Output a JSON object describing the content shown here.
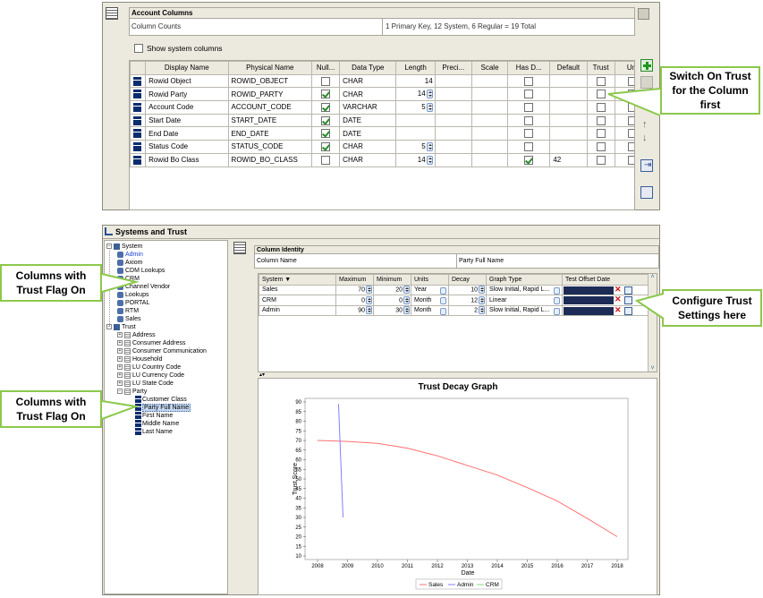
{
  "account_columns": {
    "header": "Account Columns",
    "counts_label": "Column Counts",
    "counts_value": "1 Primary Key, 12 System, 6 Regular = 19 Total",
    "show_system_label": "Show system columns",
    "columns": [
      "Display Name",
      "Physical Name",
      "Null...",
      "Data Type",
      "Length",
      "Preci...",
      "Scale",
      "Has D...",
      "Default",
      "Trust",
      "Uni"
    ],
    "rows": [
      {
        "display": "Rowid Object",
        "physical": "ROWID_OBJECT",
        "nullable": false,
        "type": "CHAR",
        "length": "14",
        "spinner": false,
        "has_default": false,
        "default": "",
        "trust": false
      },
      {
        "display": "Rowid Party",
        "physical": "ROWID_PARTY",
        "nullable": true,
        "type": "CHAR",
        "length": "14",
        "spinner": true,
        "has_default": false,
        "default": "",
        "trust": false
      },
      {
        "display": "Account Code",
        "physical": "ACCOUNT_CODE",
        "nullable": true,
        "type": "VARCHAR",
        "length": "5",
        "spinner": true,
        "has_default": false,
        "default": "",
        "trust": false
      },
      {
        "display": "Start Date",
        "physical": "START_DATE",
        "nullable": true,
        "type": "DATE",
        "length": "",
        "spinner": false,
        "has_default": false,
        "default": "",
        "trust": false
      },
      {
        "display": "End Date",
        "physical": "END_DATE",
        "nullable": true,
        "type": "DATE",
        "length": "",
        "spinner": false,
        "has_default": false,
        "default": "",
        "trust": false
      },
      {
        "display": "Status Code",
        "physical": "STATUS_CODE",
        "nullable": true,
        "type": "CHAR",
        "length": "5",
        "spinner": true,
        "has_default": false,
        "default": "",
        "trust": false
      },
      {
        "display": "Rowid Bo Class",
        "physical": "ROWID_BO_CLASS",
        "nullable": false,
        "type": "CHAR",
        "length": "14",
        "spinner": true,
        "has_default": true,
        "default": "42",
        "trust": false
      }
    ]
  },
  "callouts": {
    "switch_on": "Switch On Trust for the Column first",
    "trust_flag_1": "Columns with Trust Flag On",
    "trust_flag_2": "Columns with Trust Flag On",
    "configure": "Configure Trust Settings here"
  },
  "systems_trust": {
    "title": "Systems and Trust",
    "tree": [
      {
        "label": "System",
        "indent": 0,
        "kind": "root",
        "sel": false
      },
      {
        "label": "Admin",
        "indent": 1,
        "kind": "sys",
        "sel": false,
        "link": true
      },
      {
        "label": "Axiom",
        "indent": 1,
        "kind": "sys",
        "sel": false
      },
      {
        "label": "CDM Lookups",
        "indent": 1,
        "kind": "sys",
        "sel": false
      },
      {
        "label": "CRM",
        "indent": 1,
        "kind": "sys",
        "sel": false
      },
      {
        "label": "Channel Vendor",
        "indent": 1,
        "kind": "sys",
        "sel": false
      },
      {
        "label": "Lookups",
        "indent": 1,
        "kind": "sys",
        "sel": false
      },
      {
        "label": "PORTAL",
        "indent": 1,
        "kind": "sys",
        "sel": false
      },
      {
        "label": "RTM",
        "indent": 1,
        "kind": "sys",
        "sel": false
      },
      {
        "label": "Sales",
        "indent": 1,
        "kind": "sys",
        "sel": false
      },
      {
        "label": "Trust",
        "indent": 0,
        "kind": "root",
        "sel": false
      },
      {
        "label": "Address",
        "indent": 1,
        "kind": "tbl",
        "sel": false
      },
      {
        "label": "Consumer Address",
        "indent": 1,
        "kind": "tbl",
        "sel": false
      },
      {
        "label": "Consumer Communication",
        "indent": 1,
        "kind": "tbl",
        "sel": false
      },
      {
        "label": "Household",
        "indent": 1,
        "kind": "tbl",
        "sel": false
      },
      {
        "label": "LU Country Code",
        "indent": 1,
        "kind": "tbl",
        "sel": false
      },
      {
        "label": "LU Currency Code",
        "indent": 1,
        "kind": "tbl",
        "sel": false
      },
      {
        "label": "LU State Code",
        "indent": 1,
        "kind": "tbl",
        "sel": false
      },
      {
        "label": "Party",
        "indent": 1,
        "kind": "tbl",
        "sel": false
      },
      {
        "label": "Customer Class",
        "indent": 2,
        "kind": "col",
        "sel": false
      },
      {
        "label": "Party Full Name",
        "indent": 2,
        "kind": "col",
        "sel": true
      },
      {
        "label": "First Name",
        "indent": 2,
        "kind": "col",
        "sel": false
      },
      {
        "label": "Middle Name",
        "indent": 2,
        "kind": "col",
        "sel": false
      },
      {
        "label": "Last Name",
        "indent": 2,
        "kind": "col",
        "sel": false
      }
    ],
    "identity_header": "Column Identity",
    "column_name_label": "Column Name",
    "column_name_value": "Party Full Name",
    "settings_columns": [
      "System ▼",
      "Maximum",
      "Minimum",
      "Units",
      "Decay",
      "Graph Type",
      "Test Offset Date"
    ],
    "settings_rows": [
      {
        "system": "Sales",
        "max": "70",
        "min": "20",
        "units": "Year",
        "decay": "10",
        "graph": "Slow Initial, Rapid L..."
      },
      {
        "system": "CRM",
        "max": "0",
        "min": "0",
        "units": "Month",
        "decay": "12",
        "graph": "Linear"
      },
      {
        "system": "Admin",
        "max": "90",
        "min": "30",
        "units": "Month",
        "decay": "2",
        "graph": "Slow Initial, Rapid L..."
      }
    ]
  },
  "chart_data": {
    "type": "line",
    "title": "Trust Decay Graph",
    "xlabel": "Date",
    "ylabel": "Trust Score",
    "xlim": [
      2008,
      2018
    ],
    "ylim": [
      10,
      90
    ],
    "xticks": [
      "2008",
      "2009",
      "2010",
      "2011",
      "2012",
      "2013",
      "2014",
      "2015",
      "2016",
      "2017",
      "2018"
    ],
    "yticks": [
      "10",
      "15",
      "20",
      "25",
      "30",
      "35",
      "40",
      "45",
      "50",
      "55",
      "60",
      "65",
      "70",
      "75",
      "80",
      "85",
      "90"
    ],
    "grid": false,
    "legend_position": "bottom",
    "series": [
      {
        "name": "Sales",
        "color": "#ff6f6f",
        "x": [
          2008,
          2009,
          2010,
          2011,
          2012,
          2013,
          2014,
          2015,
          2016,
          2017,
          2018
        ],
        "y": [
          70,
          69.5,
          68.5,
          66,
          62,
          57,
          52,
          45.5,
          38.5,
          29.5,
          20
        ]
      },
      {
        "name": "Admin",
        "color": "#8080ff",
        "x": [
          2008.7,
          2008.85
        ],
        "y": [
          89,
          30
        ]
      },
      {
        "name": "CRM",
        "color": "#7fd97f",
        "x": [],
        "y": []
      }
    ]
  }
}
